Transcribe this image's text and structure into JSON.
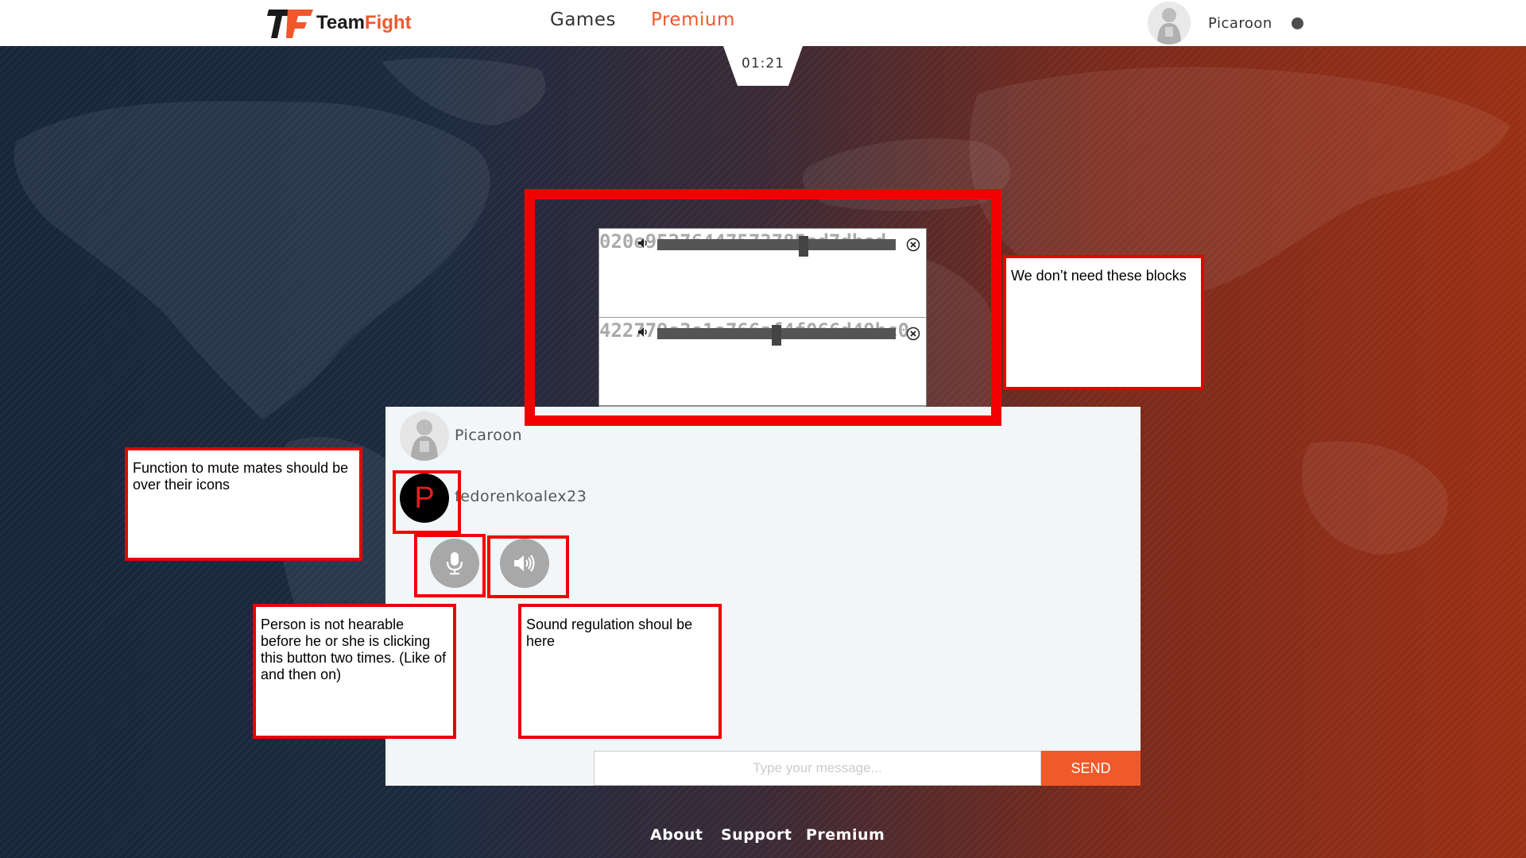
{
  "header": {
    "logo_text_1": "Team",
    "logo_text_2": "Fight",
    "nav": {
      "games": "Games",
      "premium": "Premium"
    },
    "user": {
      "name": "Picaroon",
      "status": "offline"
    }
  },
  "timer": "01:21",
  "voice_blocks": [
    {
      "id": "020e95276447573785ad7dbed",
      "volume": 0.62
    },
    {
      "id": "422779e3e1e766af4f066d49bc0",
      "volume": 0.5
    }
  ],
  "chat": {
    "members": [
      {
        "name": "Picaroon",
        "avatar_letter": ""
      },
      {
        "name": "fedorenkoalex23",
        "avatar_letter": "P"
      }
    ],
    "mic_icon": "microphone-icon",
    "speaker_icon": "speaker-icon",
    "input_placeholder": "Type your message...",
    "send_label": "SEND"
  },
  "annotations": {
    "blocks": "We don’t need these blocks",
    "mute": "Function to mute mates should be over their icons",
    "hearable": "Person is not hearable before he or she is clicking this button two times. (Like of and then on)",
    "sound": "Sound regulation shoul be here"
  },
  "footer": {
    "about": "About",
    "support": "Support",
    "premium": "Premium"
  },
  "colors": {
    "accent": "#f0572c",
    "annotation_red": "#f20000"
  }
}
